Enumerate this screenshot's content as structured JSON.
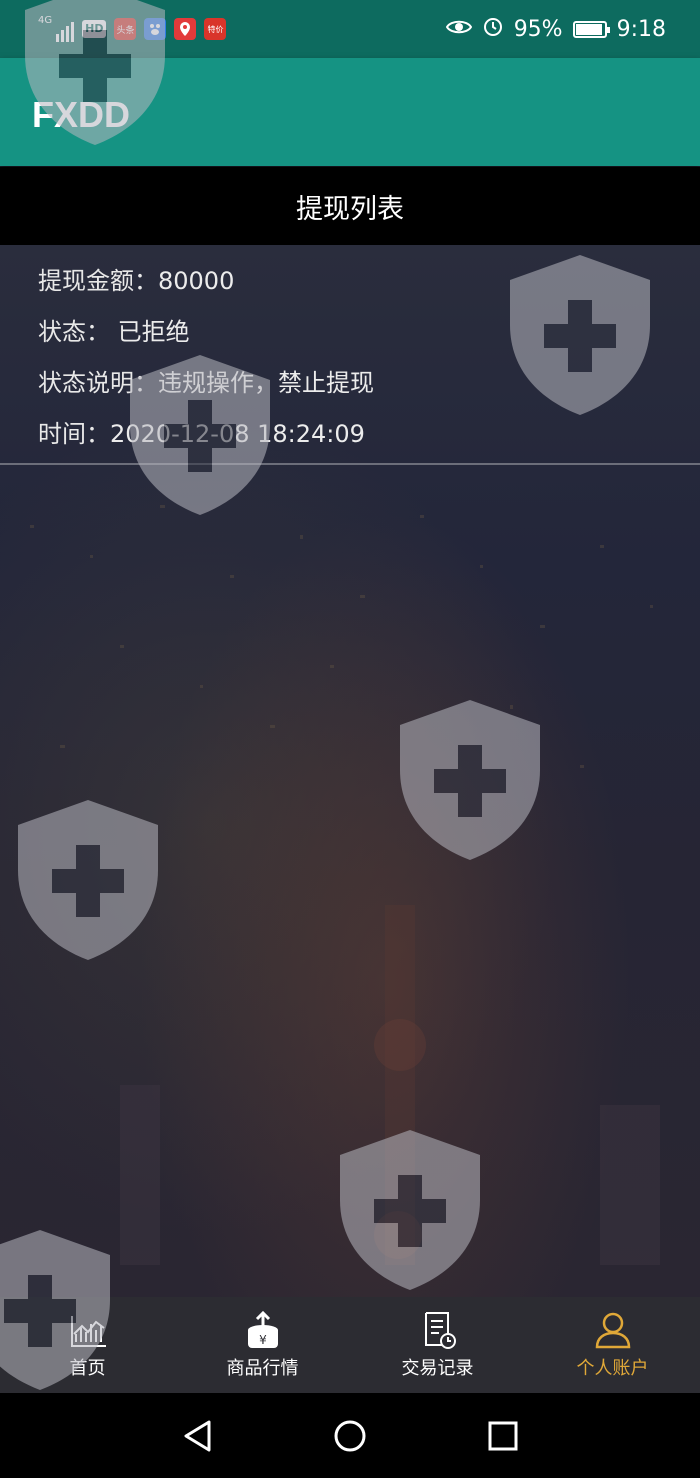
{
  "status_bar": {
    "network": "4G",
    "hd_badge": "HD",
    "app1": "头条",
    "app2": "特价",
    "battery_percent": "95%",
    "battery_level": 0.95,
    "time": "9:18"
  },
  "app_bar": {
    "title": "FXDD"
  },
  "page": {
    "title": "提现列表"
  },
  "record": {
    "amount_label": "提现金额：",
    "amount_value": "80000",
    "status_label": "状态：",
    "status_value": "已拒绝",
    "note_label": "状态说明：",
    "note_value": "违规操作，禁止提现",
    "time_label": "时间：",
    "time_value": "2020-12-08 18:24:09"
  },
  "tabs": [
    {
      "label": "首页",
      "icon": "chart-icon"
    },
    {
      "label": "商品行情",
      "icon": "yen-box-icon"
    },
    {
      "label": "交易记录",
      "icon": "document-clock-icon"
    },
    {
      "label": "个人账户",
      "icon": "user-icon"
    }
  ],
  "colors": {
    "status_bar": "#0d6b5f",
    "app_bar": "#159383",
    "tab_active": "#e0a838"
  }
}
